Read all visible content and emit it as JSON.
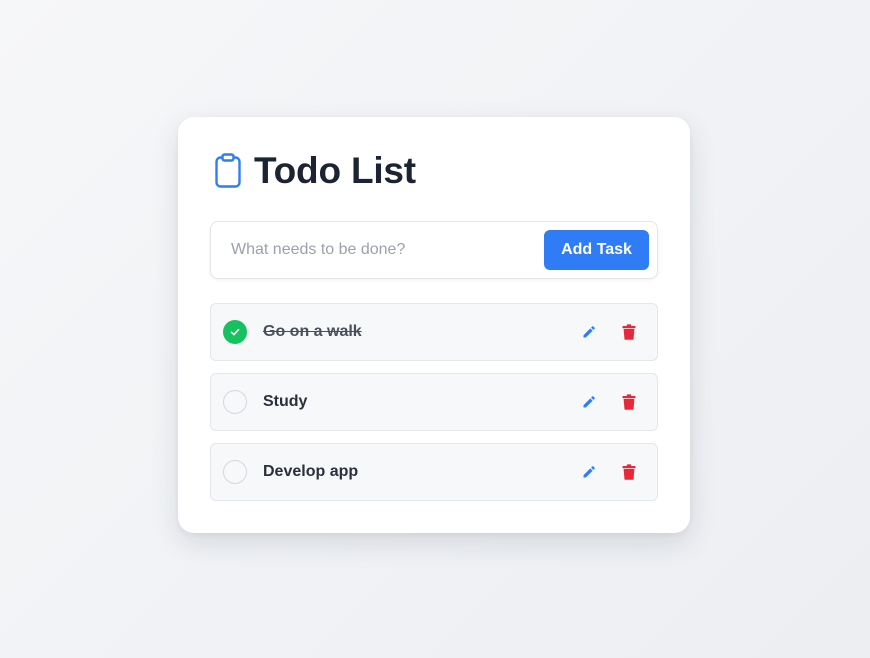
{
  "app": {
    "title": "Todo List",
    "title_icon": "clipboard-icon"
  },
  "form": {
    "placeholder": "What needs to be done?",
    "value": "",
    "add_label": "Add Task"
  },
  "colors": {
    "accent": "#2f7cf6",
    "done": "#16c25e",
    "delete": "#e8283a",
    "text": "#1c2433"
  },
  "tasks": [
    {
      "text": "Go on a walk",
      "completed": true,
      "edit_icon": "pencil-icon",
      "delete_icon": "trash-icon"
    },
    {
      "text": "Study",
      "completed": false,
      "edit_icon": "pencil-icon",
      "delete_icon": "trash-icon"
    },
    {
      "text": "Develop app",
      "completed": false,
      "edit_icon": "pencil-icon",
      "delete_icon": "trash-icon"
    }
  ]
}
